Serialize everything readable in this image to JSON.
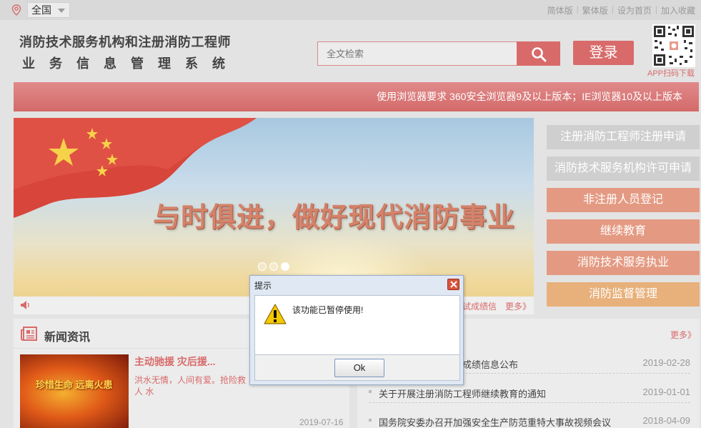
{
  "topbar": {
    "region": "全国",
    "links": [
      "简体版",
      "繁体版",
      "设为首页",
      "加入收藏"
    ]
  },
  "header": {
    "title_line1": "消防技术服务机构和注册消防工程师",
    "title_line2": "业务信息管理系统",
    "search_placeholder": "全文检索",
    "login_label": "登录",
    "qr_label": "APP扫码下载"
  },
  "notice": "使用浏览器要求 360安全浏览器9及以上版本；IE浏览器10及以上版本",
  "banner": {
    "slogan": "与时俱进，做好现代消防事业",
    "slide_count": 3,
    "active_slide": 3,
    "ticker_text": "试成绩信",
    "ticker_more": "更多》"
  },
  "side_menu": [
    {
      "label": "注册消防工程师注册申请",
      "style": "gray"
    },
    {
      "label": "消防技术服务机构许可申请",
      "style": "gray"
    },
    {
      "label": "非注册人员登记",
      "style": "salmon"
    },
    {
      "label": "继续教育",
      "style": "salmon"
    },
    {
      "label": "消防技术服务执业",
      "style": "salmon"
    },
    {
      "label": "消防监督管理",
      "style": "orange"
    }
  ],
  "news": {
    "title": "新闻资讯",
    "image_text": "珍惜生命 远离火患",
    "headline": "主动驰援 灾后援...",
    "desc": "洪水无情，人间有爱。抢险救人\n水",
    "date": "2019-07-16"
  },
  "announcements": {
    "more": "更多》",
    "items": [
      {
        "title": "消防工程师资格考试成绩信息公布",
        "date": "2019-02-28"
      },
      {
        "title": "关于开展注册消防工程师继续教育的通知",
        "date": "2019-01-01"
      },
      {
        "title": "国务院安委办召开加强安全生产防范重特大事故视频会议",
        "date": "2018-04-09"
      }
    ]
  },
  "dialog": {
    "title": "提示",
    "message": "该功能已暂停使用!",
    "ok_label": "Ok"
  },
  "colors": {
    "accent": "#d96a6a",
    "side_gray": "#cfcfcf",
    "side_salmon": "#e49a82",
    "side_orange": "#e8b07a"
  }
}
